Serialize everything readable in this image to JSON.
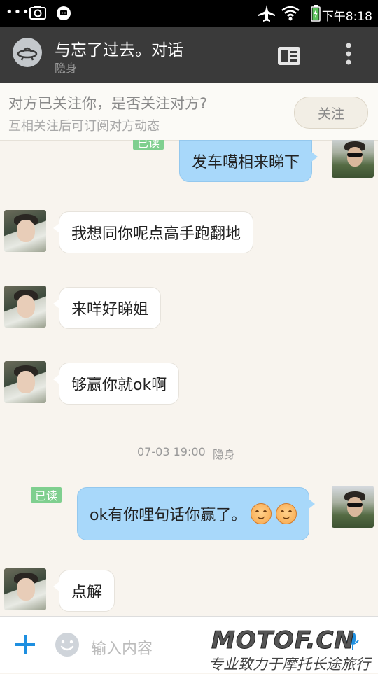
{
  "status_bar": {
    "time": "下午8:18",
    "icons": [
      "more-dots-icon",
      "screenshot-icon",
      "chat-bubble-icon",
      "airplane-mode-icon",
      "wifi-icon",
      "battery-charging-icon"
    ]
  },
  "header": {
    "contact_name": "与忘了过去。对话",
    "presence": "隐身",
    "icons": [
      "avatar-ufo-icon",
      "profile-card-icon",
      "more-vert-icon"
    ]
  },
  "follow_prompt": {
    "title": "对方已关注你，是否关注对方?",
    "subtitle": "互相关注后可订阅对方动态",
    "button_label": "关注"
  },
  "messages": [
    {
      "from": "me",
      "text": "发车噶相来睇下",
      "read_label": "已读"
    },
    {
      "from": "them",
      "text": "我想同你呢点高手跑翻地"
    },
    {
      "from": "them",
      "text": "来咩好睇姐"
    },
    {
      "from": "them",
      "text": "够赢你就ok啊"
    },
    {
      "from": "me",
      "text": "ok有你哩句话你赢了。",
      "read_label": "已读",
      "emoji": [
        "smiling-face-emoji",
        "smiling-face-emoji"
      ]
    },
    {
      "from": "them",
      "text": "点解"
    }
  ],
  "timestamp": {
    "time": "07-03 19:00",
    "status": "隐身"
  },
  "input_bar": {
    "placeholder": "输入内容",
    "icons": [
      "plus-icon",
      "emoji-icon"
    ]
  },
  "watermark": {
    "main": "MOTOF.CN",
    "sub": "专业致力于摩托长途旅行"
  },
  "colors": {
    "title_bar": "#3a3a3a",
    "chat_background": "#f8f4ee",
    "my_bubble": "#a8d8fa",
    "their_bubble": "#ffffff",
    "read_badge": "#7fcf8f",
    "accent_blue": "#1e8fe0"
  }
}
